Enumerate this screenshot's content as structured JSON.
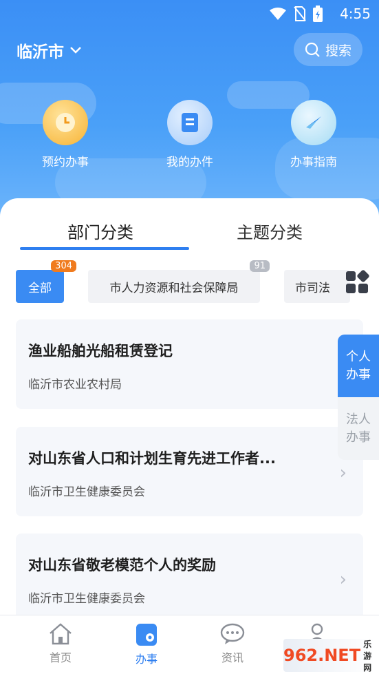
{
  "status": {
    "time": "4:55"
  },
  "header": {
    "city": "临沂市",
    "search_label": "搜索"
  },
  "quick_actions": [
    {
      "label": "预约办事",
      "icon": "clock-icon"
    },
    {
      "label": "我的办件",
      "icon": "document-icon"
    },
    {
      "label": "办事指南",
      "icon": "compass-icon"
    }
  ],
  "tabs": [
    {
      "label": "部门分类"
    },
    {
      "label": "主题分类"
    }
  ],
  "chips": [
    {
      "label": "全部",
      "badge": "304"
    },
    {
      "label": "市人力资源和社会保障局",
      "badge": "91"
    },
    {
      "label": "市司法"
    }
  ],
  "items": [
    {
      "title": "渔业船舶光船租赁登记",
      "dept": "临沂市农业农村局"
    },
    {
      "title": "对山东省人口和计划生育先进工作者...",
      "dept": "临沂市卫生健康委员会"
    },
    {
      "title": "对山东省敬老模范个人的奖励",
      "dept": "临沂市卫生健康委员会"
    }
  ],
  "side_tabs": [
    {
      "line1": "个人",
      "line2": "办事"
    },
    {
      "line1": "法人",
      "line2": "办事"
    }
  ],
  "bottom_nav": [
    {
      "label": "首页"
    },
    {
      "label": "办事"
    },
    {
      "label": "资讯"
    }
  ],
  "watermark": {
    "brand": "962.NET",
    "sub": "乐游网"
  },
  "colors": {
    "primary": "#3a8bf3",
    "badge_orange": "#f07b1e",
    "badge_gray": "#b8bcc4"
  }
}
